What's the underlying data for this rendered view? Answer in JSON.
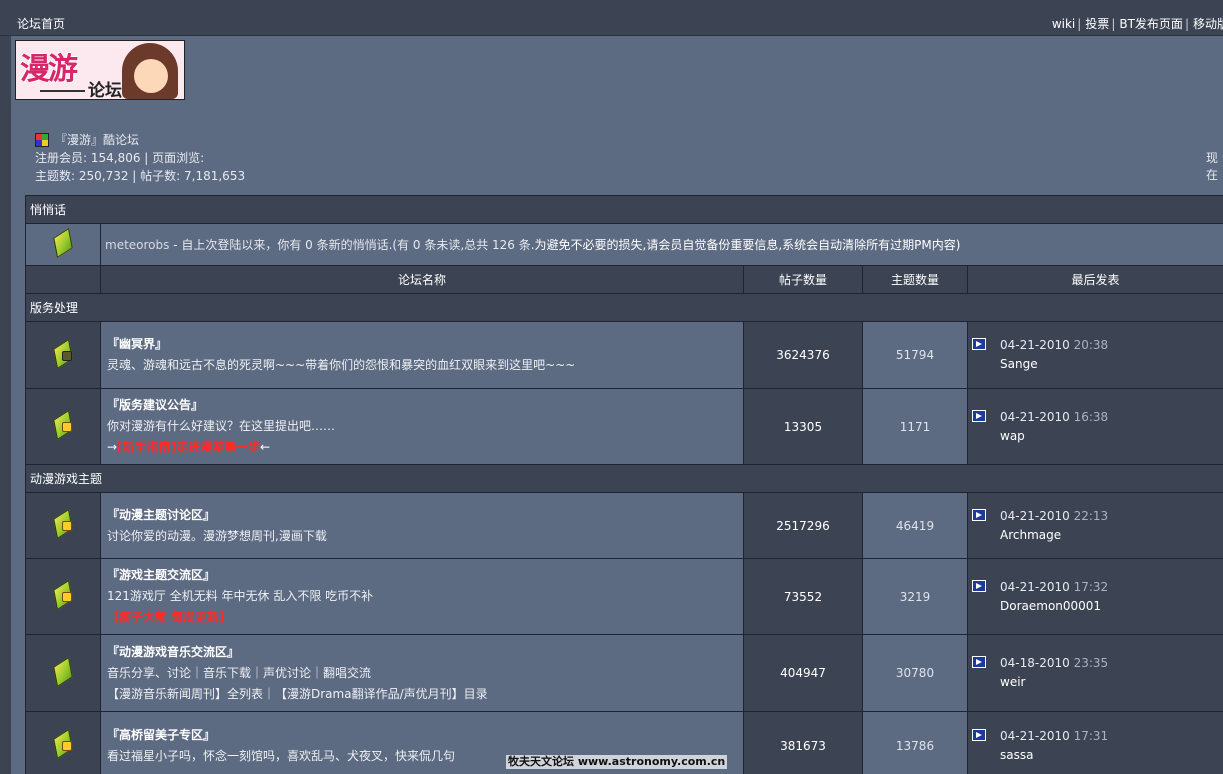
{
  "topbar": {
    "home_label": "论坛首页",
    "links": [
      "wiki",
      "投票",
      "BT发布页面",
      "移动版"
    ]
  },
  "logo": {
    "text_big": "漫游",
    "text_small": "论坛"
  },
  "info": {
    "board_name": "『漫游』酷论坛",
    "members_line": "注册会员: 154,806 | 页面浏览:",
    "stats_line": "主题数: 250,732 | 帖子数: 7,181,653",
    "right_cut": "现在"
  },
  "pm": {
    "section_label": "悄悄话",
    "user": "meteorobs",
    "message": " - 自上次登陆以来，你有  0 条新的悄悄话.(有  0 条未读,总共  126 条.",
    "warning": "为避免不必要的损失,请会员自觉备份重要信息,系统会自动清除所有过期PM内容)"
  },
  "columns": {
    "forum": "论坛名称",
    "posts": "帖子数量",
    "topics": "主题数量",
    "last": "最后发表"
  },
  "categories": [
    {
      "name": "版务处理",
      "forums": [
        {
          "name": "『幽冥界』",
          "desc": "灵魂、游魂和远古不息的死灵啊~~~带着你们的怨恨和暴突的血红双眼来到这里吧~~~",
          "extra": "",
          "posts": "3624376",
          "topics": "51794",
          "last_date": "04-21-2010",
          "last_time": "20:38",
          "last_user": "Sange",
          "icon": "dark"
        },
        {
          "name": "『版务建议公告』",
          "desc": "你对漫游有什么好建议？在这里提出吧……",
          "extra_prefix": "→",
          "extra": "[新手指南]走进漫游第一步",
          "extra_suffix": "←",
          "posts": "13305",
          "topics": "1171",
          "last_date": "04-21-2010",
          "last_time": "16:38",
          "last_user": "wap",
          "icon": "badge"
        }
      ]
    },
    {
      "name": "动漫游戏主题",
      "forums": [
        {
          "name": "『动漫主题讨论区』",
          "desc": "讨论你爱的动漫。漫游梦想周刊,漫画下载",
          "extra": "",
          "posts": "2517296",
          "topics": "46419",
          "last_date": "04-21-2010",
          "last_time": "22:13",
          "last_user": "Archmage",
          "icon": "badge"
        },
        {
          "name": "『游戏主题交流区』",
          "desc": "121游戏厅 全机无料 年中无休 乱入不限 吃币不补",
          "extra": "【瘸子大师 每周更新】",
          "posts": "73552",
          "topics": "3219",
          "last_date": "04-21-2010",
          "last_time": "17:32",
          "last_user": "Doraemon00001",
          "icon": "badge"
        },
        {
          "name": "『动漫游戏音乐交流区』",
          "desc": "音乐分享、讨论｜音乐下载｜声优讨论｜翻唱交流",
          "desc2": "【漫游音乐新闻周刊】全列表｜【漫游Drama翻译作品/声优月刊】目录",
          "extra": "",
          "posts": "404947",
          "topics": "30780",
          "last_date": "04-18-2010",
          "last_time": "23:35",
          "last_user": "weir",
          "icon": "plain"
        },
        {
          "name": "『高桥留美子专区』",
          "desc": "看过福星小子吗，怀念一刻馆吗，喜欢乱马、犬夜叉，快来侃几句",
          "extra": "",
          "posts": "381673",
          "topics": "13786",
          "last_date": "04-21-2010",
          "last_time": "17:31",
          "last_user": "sassa",
          "icon": "badge"
        }
      ]
    }
  ],
  "watermark": "牧夫天文论坛 www.astronomy.com.cn",
  "colors": {
    "bg": "#5c6a82",
    "dark_cell": "#3c4454",
    "red_link": "#ff2a2a"
  }
}
